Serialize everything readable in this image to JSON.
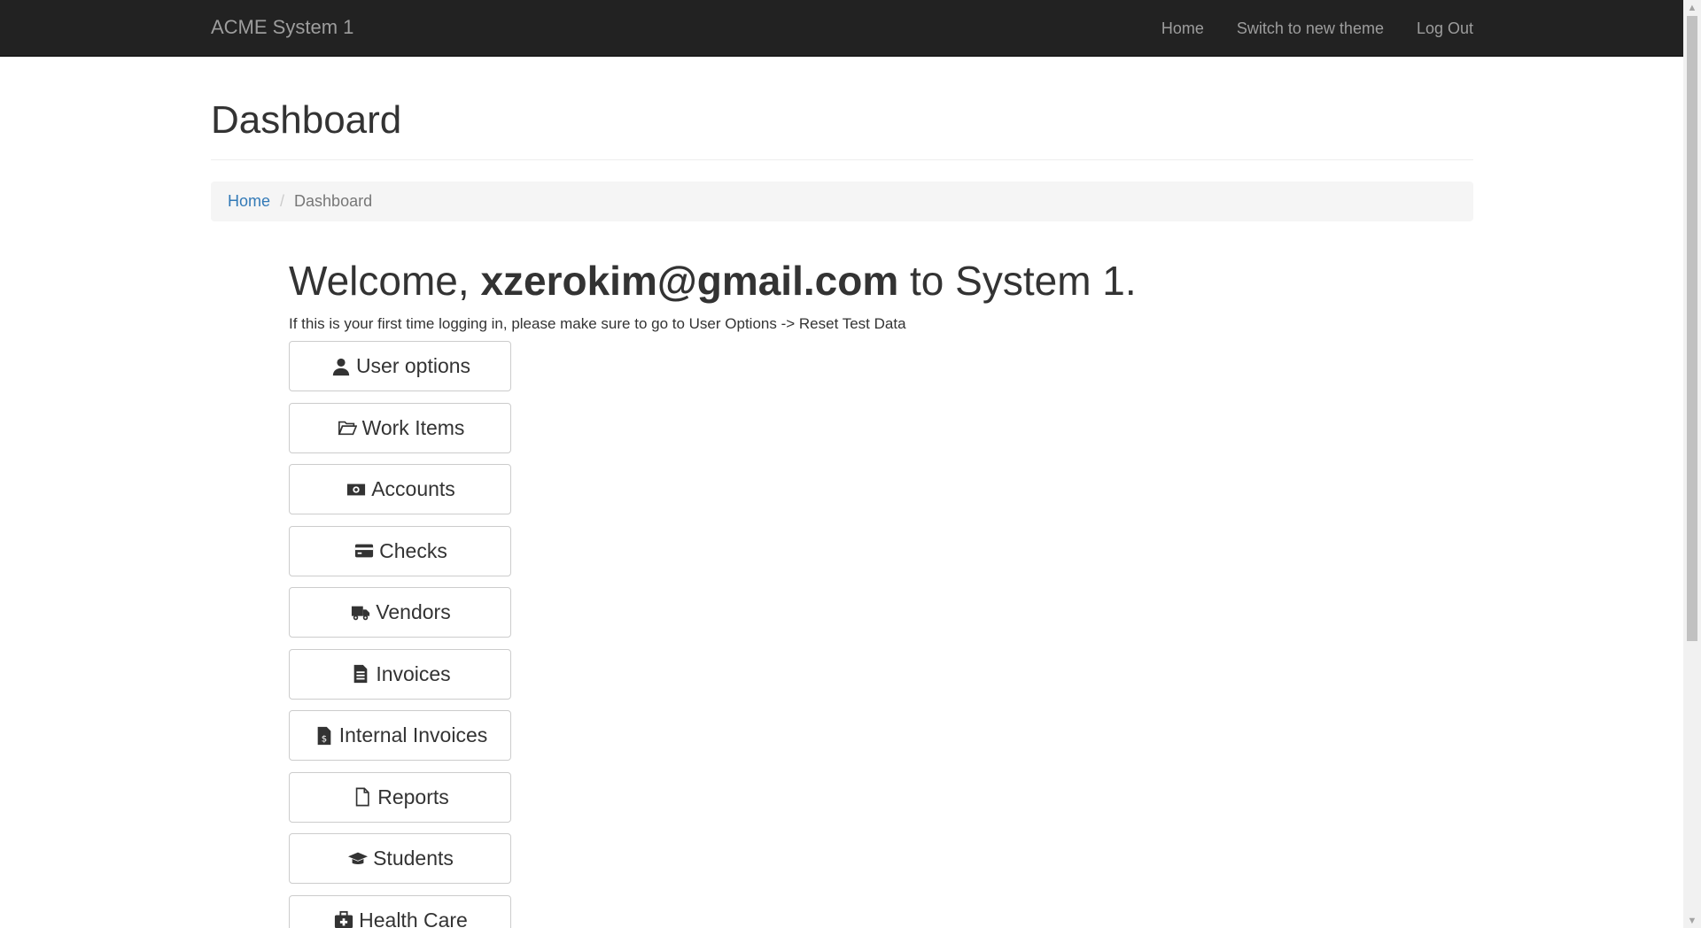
{
  "navbar": {
    "brand": "ACME System 1",
    "links": [
      "Home",
      "Switch to new theme",
      "Log Out"
    ]
  },
  "page": {
    "title": "Dashboard"
  },
  "breadcrumb": {
    "home": "Home",
    "separator": "/",
    "current": "Dashboard"
  },
  "welcome": {
    "prefix": "Welcome,",
    "user": "xzerokim@gmail.com",
    "suffix": "to System 1.",
    "info": "If this is your first time logging in, please make sure to go to User Options -> Reset Test Data"
  },
  "buttons": [
    {
      "label": "User options",
      "icon": "user-icon"
    },
    {
      "label": "Work Items",
      "icon": "folder-open-icon"
    },
    {
      "label": "Accounts",
      "icon": "money-icon"
    },
    {
      "label": "Checks",
      "icon": "credit-card-icon"
    },
    {
      "label": "Vendors",
      "icon": "truck-icon"
    },
    {
      "label": "Invoices",
      "icon": "file-text-icon"
    },
    {
      "label": "Internal Invoices",
      "icon": "file-invoice-dollar-icon"
    },
    {
      "label": "Reports",
      "icon": "file-icon"
    },
    {
      "label": "Students",
      "icon": "graduation-cap-icon"
    },
    {
      "label": "Health Care",
      "icon": "medkit-icon"
    }
  ],
  "colors": {
    "navbar_bg": "#222222",
    "nav_text": "#9d9d9d",
    "link": "#337ab7",
    "breadcrumb_bg": "#f5f5f5"
  }
}
